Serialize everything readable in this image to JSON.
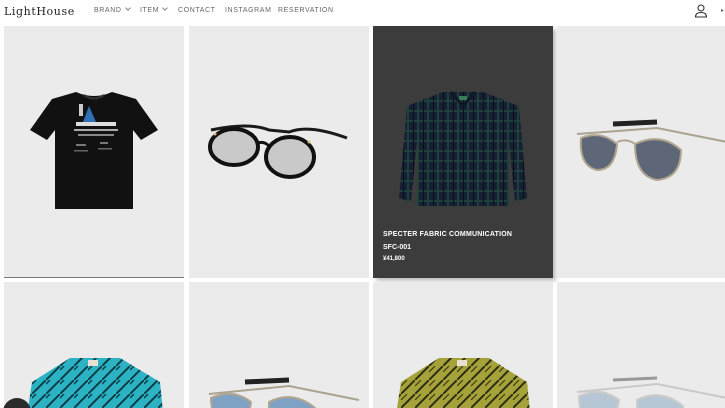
{
  "header": {
    "logo": "LightHouse",
    "nav": [
      {
        "label": "BRAND",
        "has_dropdown": true
      },
      {
        "label": "ITEM",
        "has_dropdown": true
      },
      {
        "label": "CONTACT",
        "has_dropdown": false
      },
      {
        "label": "INSTAGRAM",
        "has_dropdown": false
      },
      {
        "label": "RESERVATION",
        "has_dropdown": false
      }
    ],
    "account_icon": "user-icon"
  },
  "products": [
    {
      "kind": "t-shirt",
      "icon": "tshirt-image"
    },
    {
      "kind": "black sunglasses",
      "icon": "black-glasses-image"
    },
    {
      "kind": "plaid shirt",
      "icon": "plaid-shirt-image",
      "hovered": true,
      "brand": "SPECTER FABRIC COMMUNICATION",
      "model": "SFC-001",
      "price": "¥41,800"
    },
    {
      "kind": "aviator sunglasses",
      "icon": "aviator-glasses-image"
    },
    {
      "kind": "turquoise print shirt",
      "icon": "turquoise-shirt-image"
    },
    {
      "kind": "aviator sunglasses",
      "icon": "blue-aviator-image"
    },
    {
      "kind": "olive print shirt",
      "icon": "olive-shirt-image"
    },
    {
      "kind": "aviator sunglasses",
      "icon": "silver-aviator-image"
    }
  ],
  "colors": {
    "card_bg": "#ebebeb",
    "hover_overlay": "#3c3c3c",
    "nav_text": "#666666"
  }
}
